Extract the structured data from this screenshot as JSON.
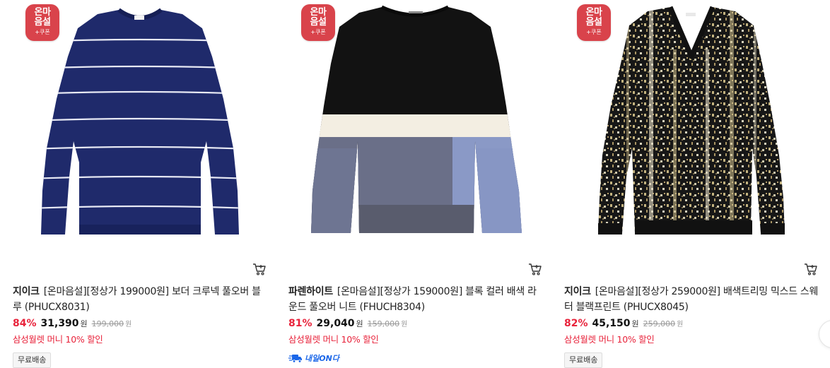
{
  "products": [
    {
      "badge": {
        "main": "온마음설",
        "sub": "+쿠폰"
      },
      "brand": "지이크",
      "name": "[온마음설][정상가 199000원] 보더 크루넥 풀오버 블루 (PHUCX8031)",
      "discount": "84%",
      "price": "31,390",
      "price_unit": "원",
      "original_price": "199,000",
      "original_unit": "원",
      "card_promo": "삼성월렛 머니 10% 할인",
      "tag": "무료배송"
    },
    {
      "badge": {
        "main": "온마음설",
        "sub": "+쿠폰"
      },
      "brand": "파렌하이트",
      "name": "[온마음설][정상가 159000원] 블록 컬러 배색 라운드 풀오버 니트 (FHUCH8304)",
      "discount": "81%",
      "price": "29,040",
      "price_unit": "원",
      "original_price": "159,000",
      "original_unit": "원",
      "card_promo": "삼성월렛 머니 10% 할인",
      "delivery": "내일ON다"
    },
    {
      "badge": {
        "main": "온마음설",
        "sub": "+쿠폰"
      },
      "brand": "지이크",
      "name": "[온마음설][정상가 259000원] 배색트리밍 믹스드 스웨터 블랙프린트 (PHUCX8045)",
      "discount": "82%",
      "price": "45,150",
      "price_unit": "원",
      "original_price": "259,000",
      "original_unit": "원",
      "card_promo": "삼성월렛 머니 10% 할인",
      "tag": "무료배송"
    }
  ],
  "colors": {
    "badge": "#d9434b",
    "discount": "#e8233b",
    "promo": "#e8233b",
    "delivery": "#1a66e8"
  },
  "icons": {
    "cart": "cart-icon",
    "delivery": "truck-icon",
    "next": "chevron-right-icon"
  }
}
